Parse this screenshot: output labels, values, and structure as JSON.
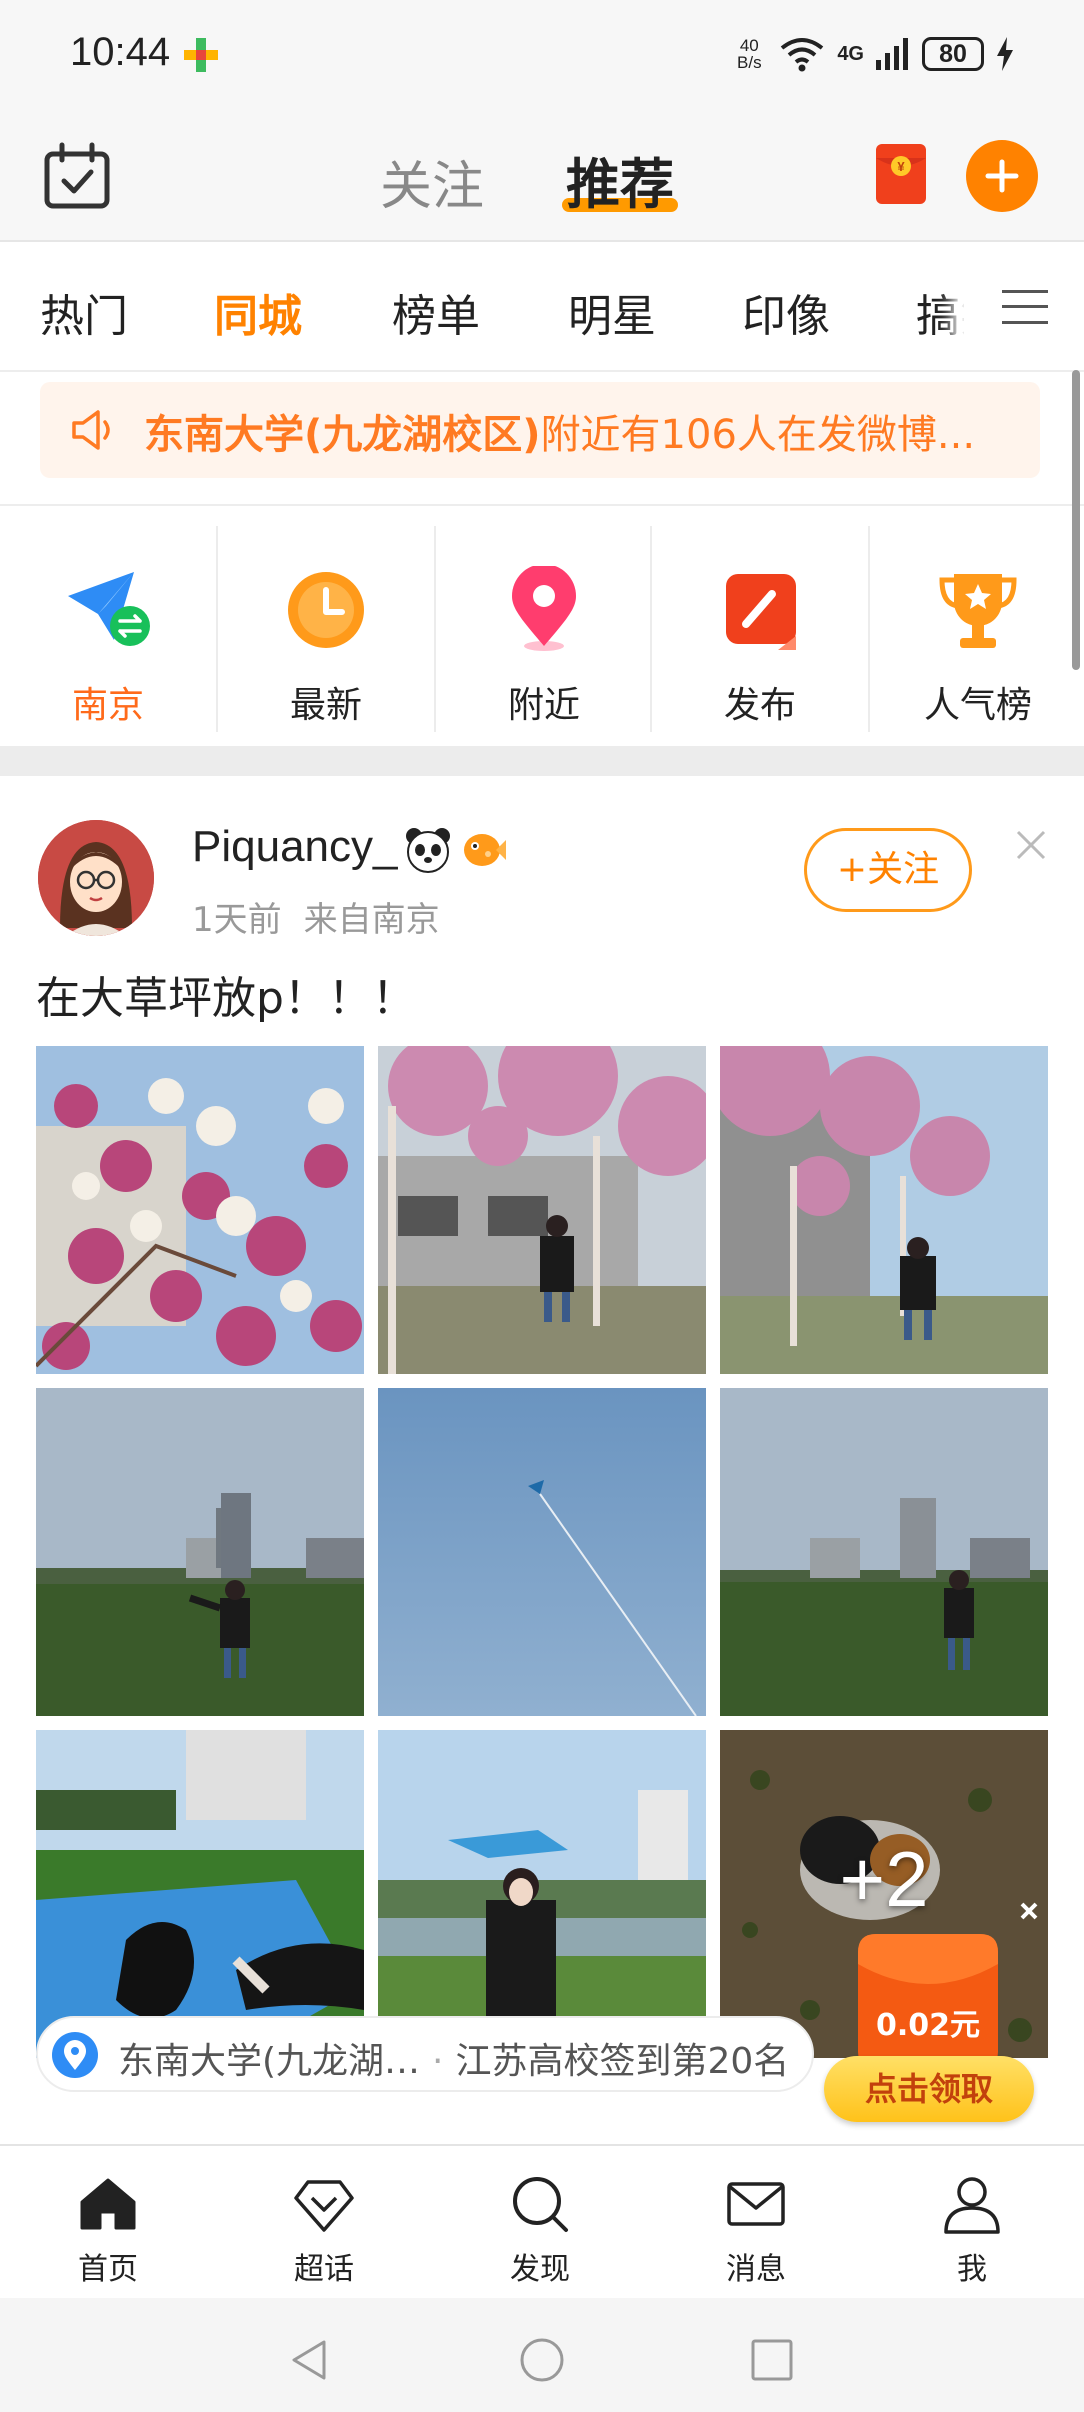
{
  "status_bar": {
    "time": "10:44",
    "net_speed_top": "40",
    "net_speed_bottom": "B/s",
    "signal_label": "4G",
    "battery": "80"
  },
  "header": {
    "tabs": [
      {
        "label": "关注",
        "active": false
      },
      {
        "label": "推荐",
        "active": true
      }
    ],
    "red_packet_glyph": "¥"
  },
  "channels": [
    "热门",
    "同城",
    "榜单",
    "明星",
    "印像",
    "搞笑"
  ],
  "active_channel": "同城",
  "notice": {
    "highlight": "东南大学(九龙湖校区)",
    "rest": "附近有106人在发微博..."
  },
  "quick_links": [
    {
      "label": "南京",
      "icon": "paper-plane-icon"
    },
    {
      "label": "最新",
      "icon": "clock-icon"
    },
    {
      "label": "附近",
      "icon": "location-pin-icon"
    },
    {
      "label": "发布",
      "icon": "edit-icon"
    },
    {
      "label": "人气榜",
      "icon": "trophy-icon"
    }
  ],
  "post": {
    "username": "Piquancy_",
    "time": "1天前",
    "source": "来自南京",
    "follow_label": "+关注",
    "text": "在大草坪放p！！！",
    "more_photos": "+2",
    "location": "东南大学(九龙湖…",
    "location_extra": "江苏高校签到第20名"
  },
  "floating_ad": {
    "amount": "0.02元",
    "button": "点击领取"
  },
  "bottom_nav": [
    {
      "label": "首页",
      "icon": "home-icon"
    },
    {
      "label": "超话",
      "icon": "diamond-icon"
    },
    {
      "label": "发现",
      "icon": "search-icon"
    },
    {
      "label": "消息",
      "icon": "mail-icon"
    },
    {
      "label": "我",
      "icon": "profile-icon"
    }
  ],
  "colors": {
    "accent": "#ff8200",
    "notice_text": "#ff7a22",
    "notice_bg": "#fff4ec"
  }
}
